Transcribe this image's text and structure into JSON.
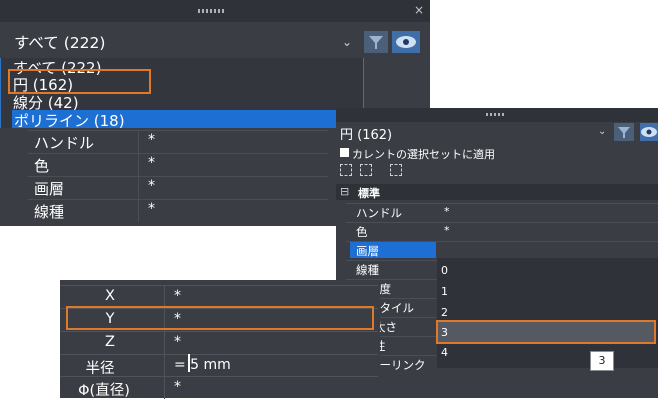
{
  "panel1": {
    "combo": "すべて (222)",
    "list": [
      "すべて (222)",
      "円 (162)",
      "線分 (42)",
      "ポリライン (18)"
    ],
    "rows": [
      {
        "key": "ハンドル",
        "value": "*"
      },
      {
        "key": "色",
        "value": "*"
      },
      {
        "key": "画層",
        "value": "*"
      },
      {
        "key": "線種",
        "value": "*"
      }
    ],
    "close": "×"
  },
  "panel2": {
    "combo": "円 (162)",
    "checkbox_label": "カレントの選択セットに適用",
    "section_sign": "⊟",
    "section": "標準",
    "rows": [
      {
        "key": "ハンドル",
        "value": "*"
      },
      {
        "key": "色",
        "value": "*"
      },
      {
        "key": "画層",
        "value": ""
      },
      {
        "key": "線種",
        "value": ""
      },
      {
        "key": "尺度",
        "value": ""
      },
      {
        "key": "スタイル",
        "value": ""
      },
      {
        "key": "太さ",
        "value": ""
      },
      {
        "key": "性",
        "value": ""
      },
      {
        "key": "パーリンク",
        "value": "*"
      }
    ],
    "dropdown": [
      "0",
      "1",
      "2",
      "3",
      "4"
    ],
    "tooltip": "3"
  },
  "panel3": {
    "rows": [
      {
        "key": "X",
        "value": "*"
      },
      {
        "key": "Y",
        "value": "*"
      },
      {
        "key": "Z",
        "value": "*"
      },
      {
        "key": "半径",
        "value": "=  5 mm"
      },
      {
        "key": "Φ(直径)",
        "value": "*"
      }
    ]
  },
  "colors": {
    "accent_highlight": "#e0782a",
    "selection": "#1d6fd4",
    "panel": "#3a3d44"
  }
}
